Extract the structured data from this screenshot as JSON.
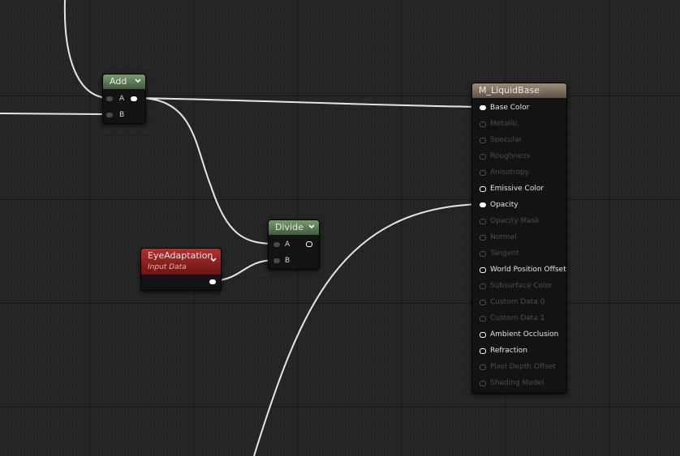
{
  "editor": {
    "view": "material-graph"
  },
  "nodes": {
    "add": {
      "title": "Add",
      "pins": {
        "a": "A",
        "b": "B"
      }
    },
    "divide": {
      "title": "Divide",
      "pins": {
        "a": "A",
        "b": "B"
      }
    },
    "eye_adaptation": {
      "title": "EyeAdaptation",
      "subtitle": "Input Data"
    },
    "material": {
      "title": "M_LiquidBase",
      "inputs": [
        {
          "label": "Base Color",
          "state": "connected"
        },
        {
          "label": "Metallic",
          "state": "disabled"
        },
        {
          "label": "Specular",
          "state": "disabled"
        },
        {
          "label": "Roughness",
          "state": "disabled"
        },
        {
          "label": "Anisotropy",
          "state": "disabled"
        },
        {
          "label": "Emissive Color",
          "state": "enabled"
        },
        {
          "label": "Opacity",
          "state": "connected"
        },
        {
          "label": "Opacity Mask",
          "state": "disabled"
        },
        {
          "label": "Normal",
          "state": "disabled"
        },
        {
          "label": "Tangent",
          "state": "disabled"
        },
        {
          "label": "World Position Offset",
          "state": "enabled"
        },
        {
          "label": "Subsurface Color",
          "state": "disabled"
        },
        {
          "label": "Custom Data 0",
          "state": "disabled"
        },
        {
          "label": "Custom Data 1",
          "state": "disabled"
        },
        {
          "label": "Ambient Occlusion",
          "state": "enabled"
        },
        {
          "label": "Refraction",
          "state": "enabled"
        },
        {
          "label": "Pixel Depth Offset",
          "state": "disabled"
        },
        {
          "label": "Shading Model",
          "state": "disabled"
        }
      ]
    }
  },
  "colors": {
    "wire": "#e6e6e6",
    "canvas": "#262626",
    "add_header": "#5c7a56",
    "divide_header": "#5c7a56",
    "eye_adaptation_header": "#8e2020",
    "material_header": "#7f7060"
  }
}
